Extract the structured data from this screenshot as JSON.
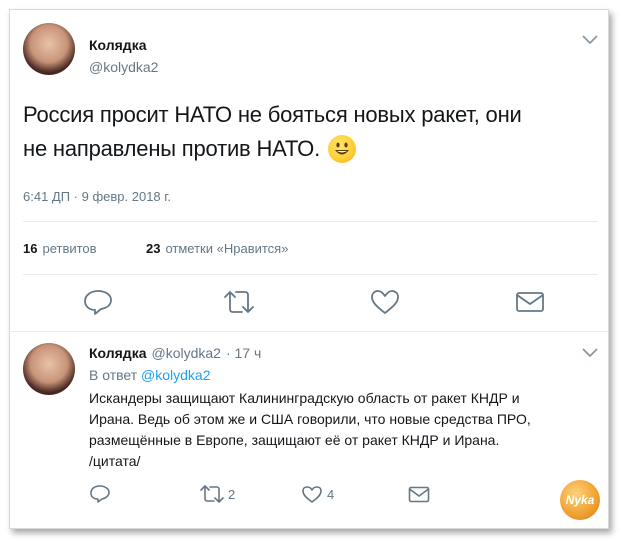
{
  "tweet": {
    "author_name": "Колядка",
    "author_handle": "@kolydka2",
    "text_line1": "Россия просит НАТО не бояться новых ракет, они",
    "text_line2": "не направлены против НАТО.",
    "timestamp": "6:41 ДП · 9 февр. 2018 г.",
    "retweets_count": "16",
    "retweets_label": "ретвитов",
    "likes_count": "23",
    "likes_label": "отметки «Нравится»"
  },
  "reply": {
    "author_name": "Колядка",
    "author_handle": "@kolydka2",
    "time_ago": "· 17 ч",
    "in_reply_prefix": "В ответ",
    "in_reply_handle": "@kolydka2",
    "text_line1": "Искандеры защищают Калининградскую область от ракет КНДР и",
    "text_line2": "Ирана. Ведь об этом же и США говорили, что новые средства ПРО,",
    "text_line3": "размещённые в Европе, защищают её от ракет КНДР и Ирана.",
    "text_line4": "/цитата/",
    "retweets_count": "2",
    "likes_count": "4"
  },
  "watermark": {
    "text": "Nyka"
  },
  "icons": {
    "reply": "reply-icon",
    "retweet": "retweet-icon",
    "like": "heart-icon",
    "message": "envelope-icon",
    "menu": "chevron-down-icon",
    "emoji": "grinning-face-icon"
  },
  "colors": {
    "text": "#14171a",
    "muted": "#657786",
    "link": "#1da1f2",
    "icon": "#657786",
    "divider": "#e6ecf0"
  }
}
